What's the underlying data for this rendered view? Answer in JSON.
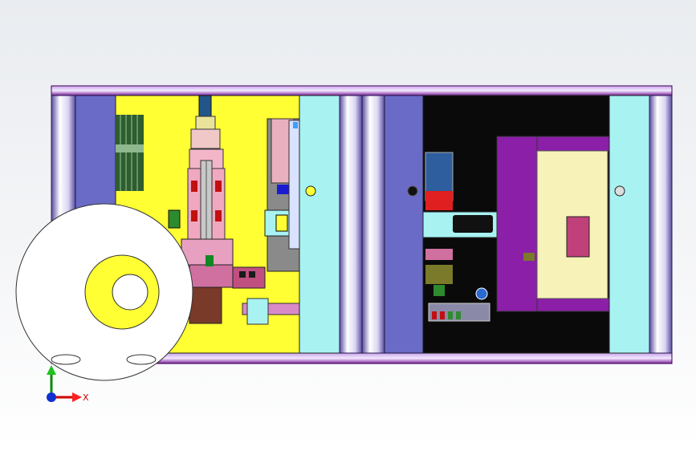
{
  "app": {
    "view": "cad-model-viewport"
  },
  "colors": {
    "background_top": "#e9ecf0",
    "frame_purple": "#7a1f9a",
    "frame_purple_light": "#c9a5e8",
    "side_cover_blue": "#6a6ac7",
    "roller_cyan": "#a8f2f2",
    "left_bay_yellow": "#ffff33",
    "right_bay_black": "#0a0a0a",
    "plate_cream": "#f7f3b8",
    "plate_purple": "#8b1fa8",
    "disk_white": "#ffffff",
    "axis_x": "#d00000",
    "axis_y": "#0a8a0a",
    "axis_origin": "#1030d0"
  },
  "triad": {
    "x_label": "X",
    "icon": "coordinate-triad-icon"
  }
}
